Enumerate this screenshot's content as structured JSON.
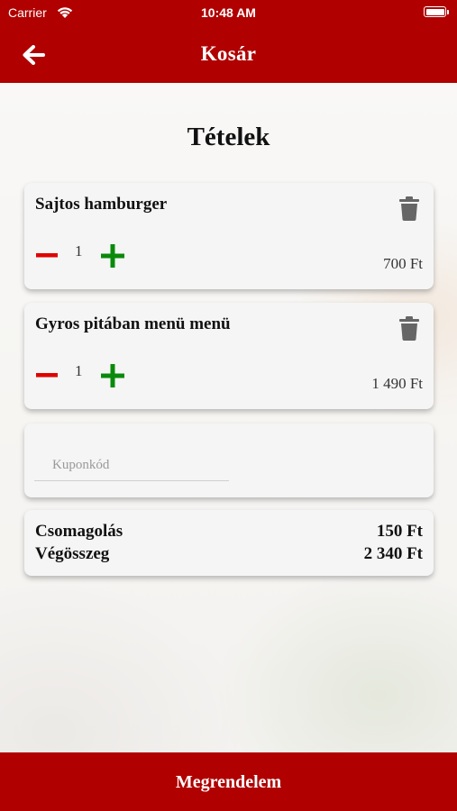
{
  "status_bar": {
    "carrier": "Carrier",
    "time": "10:48 AM",
    "battery_level": 1.0
  },
  "header": {
    "title": "Kosár",
    "back_icon": "arrow-left-icon",
    "color": "#b00000"
  },
  "section_title": "Tételek",
  "items": [
    {
      "name": "Sajtos hamburger",
      "quantity": "1",
      "price": "700 Ft"
    },
    {
      "name": "Gyros pitában menü menü",
      "quantity": "1",
      "price": "1 490 Ft"
    }
  ],
  "coupon": {
    "placeholder": "Kuponkód",
    "value": ""
  },
  "summary": {
    "packaging_label": "Csomagolás",
    "packaging_value": "150 Ft",
    "total_label": "Végösszeg",
    "total_value": "2 340 Ft"
  },
  "order_button": {
    "label": "Megrendelem"
  },
  "colors": {
    "primary": "#b00000",
    "minus": "#e00000",
    "plus": "#0a8a0a",
    "trash": "#666666"
  }
}
